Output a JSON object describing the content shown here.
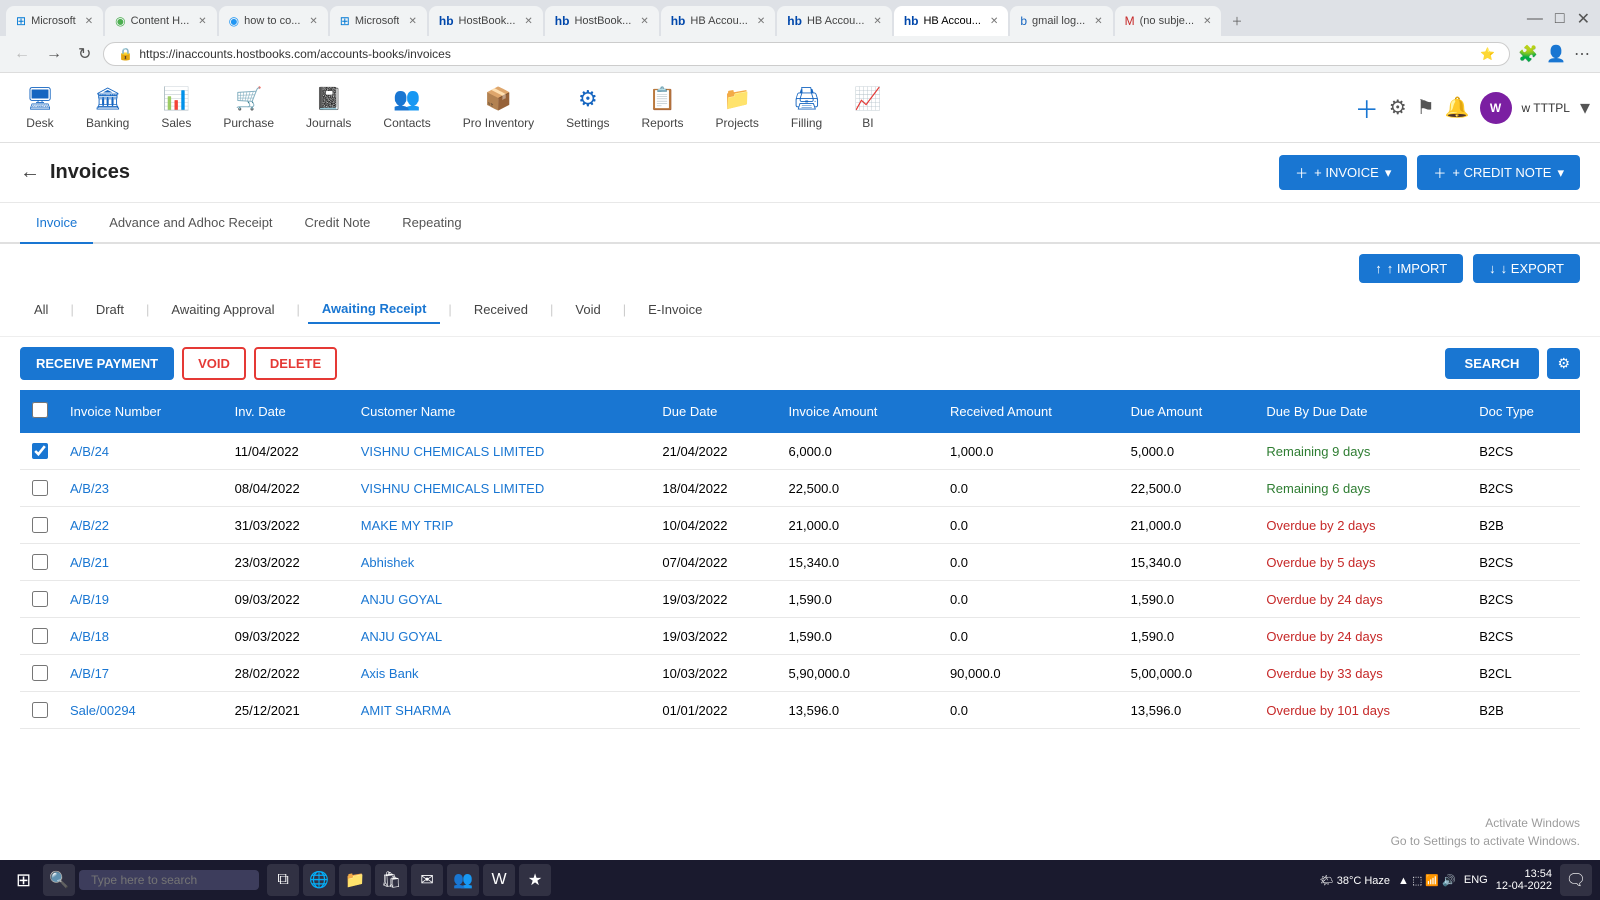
{
  "browser": {
    "tabs": [
      {
        "label": "Microsoft",
        "active": false,
        "color": "#0078d4"
      },
      {
        "label": "Content H...",
        "active": false,
        "color": "#4caf50"
      },
      {
        "label": "how to co...",
        "active": false,
        "color": "#2196f3"
      },
      {
        "label": "Microsoft",
        "active": false,
        "color": "#0078d4"
      },
      {
        "label": "HostBook...",
        "active": false,
        "color": "#0047ab"
      },
      {
        "label": "HostBook...",
        "active": false,
        "color": "#0047ab"
      },
      {
        "label": "HB Accou...",
        "active": false,
        "color": "#0047ab"
      },
      {
        "label": "HB Accou...",
        "active": false,
        "color": "#0047ab"
      },
      {
        "label": "HB Accou...",
        "active": true,
        "color": "#0047ab"
      },
      {
        "label": "gmail log...",
        "active": false,
        "color": "#1565c0"
      },
      {
        "label": "(no subje...",
        "active": false,
        "color": "#c62828"
      }
    ],
    "address": "https://inaccounts.hostbooks.com/accounts-books/invoices"
  },
  "nav": {
    "items": [
      {
        "label": "Desk",
        "icon": "🖥"
      },
      {
        "label": "Banking",
        "icon": "🏛"
      },
      {
        "label": "Sales",
        "icon": "📊"
      },
      {
        "label": "Purchase",
        "icon": "🛒"
      },
      {
        "label": "Journals",
        "icon": "📓"
      },
      {
        "label": "Contacts",
        "icon": "👥"
      },
      {
        "label": "Pro Inventory",
        "icon": "📦"
      },
      {
        "label": "Settings",
        "icon": "⚙"
      },
      {
        "label": "Reports",
        "icon": "📋"
      },
      {
        "label": "Projects",
        "icon": "📁"
      },
      {
        "label": "Filling",
        "icon": "🖨"
      },
      {
        "label": "BI",
        "icon": "📈"
      }
    ],
    "company": "w TTTPL"
  },
  "page": {
    "title": "Invoices",
    "back_label": "←",
    "actions": {
      "invoice_label": "+ INVOICE",
      "credit_note_label": "+ CREDIT NOTE",
      "import_label": "↑ IMPORT",
      "export_label": "↓ EXPORT"
    }
  },
  "tabs": [
    {
      "label": "Invoice",
      "active": true
    },
    {
      "label": "Advance and Adhoc Receipt",
      "active": false
    },
    {
      "label": "Credit Note",
      "active": false
    },
    {
      "label": "Repeating",
      "active": false
    }
  ],
  "filter_tabs": [
    {
      "label": "All",
      "active": false
    },
    {
      "label": "Draft",
      "active": false
    },
    {
      "label": "Awaiting Approval",
      "active": false
    },
    {
      "label": "Awaiting Receipt",
      "active": true
    },
    {
      "label": "Received",
      "active": false
    },
    {
      "label": "Void",
      "active": false
    },
    {
      "label": "E-Invoice",
      "active": false
    }
  ],
  "action_buttons": {
    "receive_payment": "RECEIVE PAYMENT",
    "void": "VOID",
    "delete": "DELETE",
    "search": "SEARCH"
  },
  "table": {
    "headers": [
      "",
      "Invoice Number",
      "Inv. Date",
      "Customer Name",
      "Due Date",
      "Invoice Amount",
      "Received Amount",
      "Due Amount",
      "Due By Due Date",
      "Doc Type"
    ],
    "rows": [
      {
        "checked": true,
        "invoice_number": "A/B/24",
        "inv_date": "11/04/2022",
        "customer_name": "VISHNU CHEMICALS LIMITED",
        "due_date": "21/04/2022",
        "invoice_amount": "6,000.0",
        "received_amount": "1,000.0",
        "due_amount": "5,000.0",
        "due_by_due_date": "Remaining 9 days",
        "due_status": "green",
        "doc_type": "B2CS"
      },
      {
        "checked": false,
        "invoice_number": "A/B/23",
        "inv_date": "08/04/2022",
        "customer_name": "VISHNU CHEMICALS LIMITED",
        "due_date": "18/04/2022",
        "invoice_amount": "22,500.0",
        "received_amount": "0.0",
        "due_amount": "22,500.0",
        "due_by_due_date": "Remaining 6 days",
        "due_status": "green",
        "doc_type": "B2CS"
      },
      {
        "checked": false,
        "invoice_number": "A/B/22",
        "inv_date": "31/03/2022",
        "customer_name": "MAKE MY TRIP",
        "due_date": "10/04/2022",
        "invoice_amount": "21,000.0",
        "received_amount": "0.0",
        "due_amount": "21,000.0",
        "due_by_due_date": "Overdue by 2 days",
        "due_status": "red",
        "doc_type": "B2B"
      },
      {
        "checked": false,
        "invoice_number": "A/B/21",
        "inv_date": "23/03/2022",
        "customer_name": "Abhishek",
        "due_date": "07/04/2022",
        "invoice_amount": "15,340.0",
        "received_amount": "0.0",
        "due_amount": "15,340.0",
        "due_by_due_date": "Overdue by 5 days",
        "due_status": "red",
        "doc_type": "B2CS"
      },
      {
        "checked": false,
        "invoice_number": "A/B/19",
        "inv_date": "09/03/2022",
        "customer_name": "ANJU GOYAL",
        "due_date": "19/03/2022",
        "invoice_amount": "1,590.0",
        "received_amount": "0.0",
        "due_amount": "1,590.0",
        "due_by_due_date": "Overdue by 24 days",
        "due_status": "red",
        "doc_type": "B2CS"
      },
      {
        "checked": false,
        "invoice_number": "A/B/18",
        "inv_date": "09/03/2022",
        "customer_name": "ANJU GOYAL",
        "due_date": "19/03/2022",
        "invoice_amount": "1,590.0",
        "received_amount": "0.0",
        "due_amount": "1,590.0",
        "due_by_due_date": "Overdue by 24 days",
        "due_status": "red",
        "doc_type": "B2CS"
      },
      {
        "checked": false,
        "invoice_number": "A/B/17",
        "inv_date": "28/02/2022",
        "customer_name": "Axis Bank",
        "due_date": "10/03/2022",
        "invoice_amount": "5,90,000.0",
        "received_amount": "90,000.0",
        "due_amount": "5,00,000.0",
        "due_by_due_date": "Overdue by 33 days",
        "due_status": "red",
        "doc_type": "B2CL"
      },
      {
        "checked": false,
        "invoice_number": "Sale/00294",
        "inv_date": "25/12/2021",
        "customer_name": "AMIT SHARMA",
        "due_date": "01/01/2022",
        "invoice_amount": "13,596.0",
        "received_amount": "0.0",
        "due_amount": "13,596.0",
        "due_by_due_date": "Overdue by 101 days",
        "due_status": "red",
        "doc_type": "B2B"
      }
    ]
  },
  "taskbar": {
    "search_placeholder": "Type here to search",
    "time": "13:54",
    "date": "12-04-2022",
    "weather": "38°C Haze",
    "language": "ENG"
  },
  "watermark": {
    "line1": "Activate Windows",
    "line2": "Go to Settings to activate Windows."
  }
}
